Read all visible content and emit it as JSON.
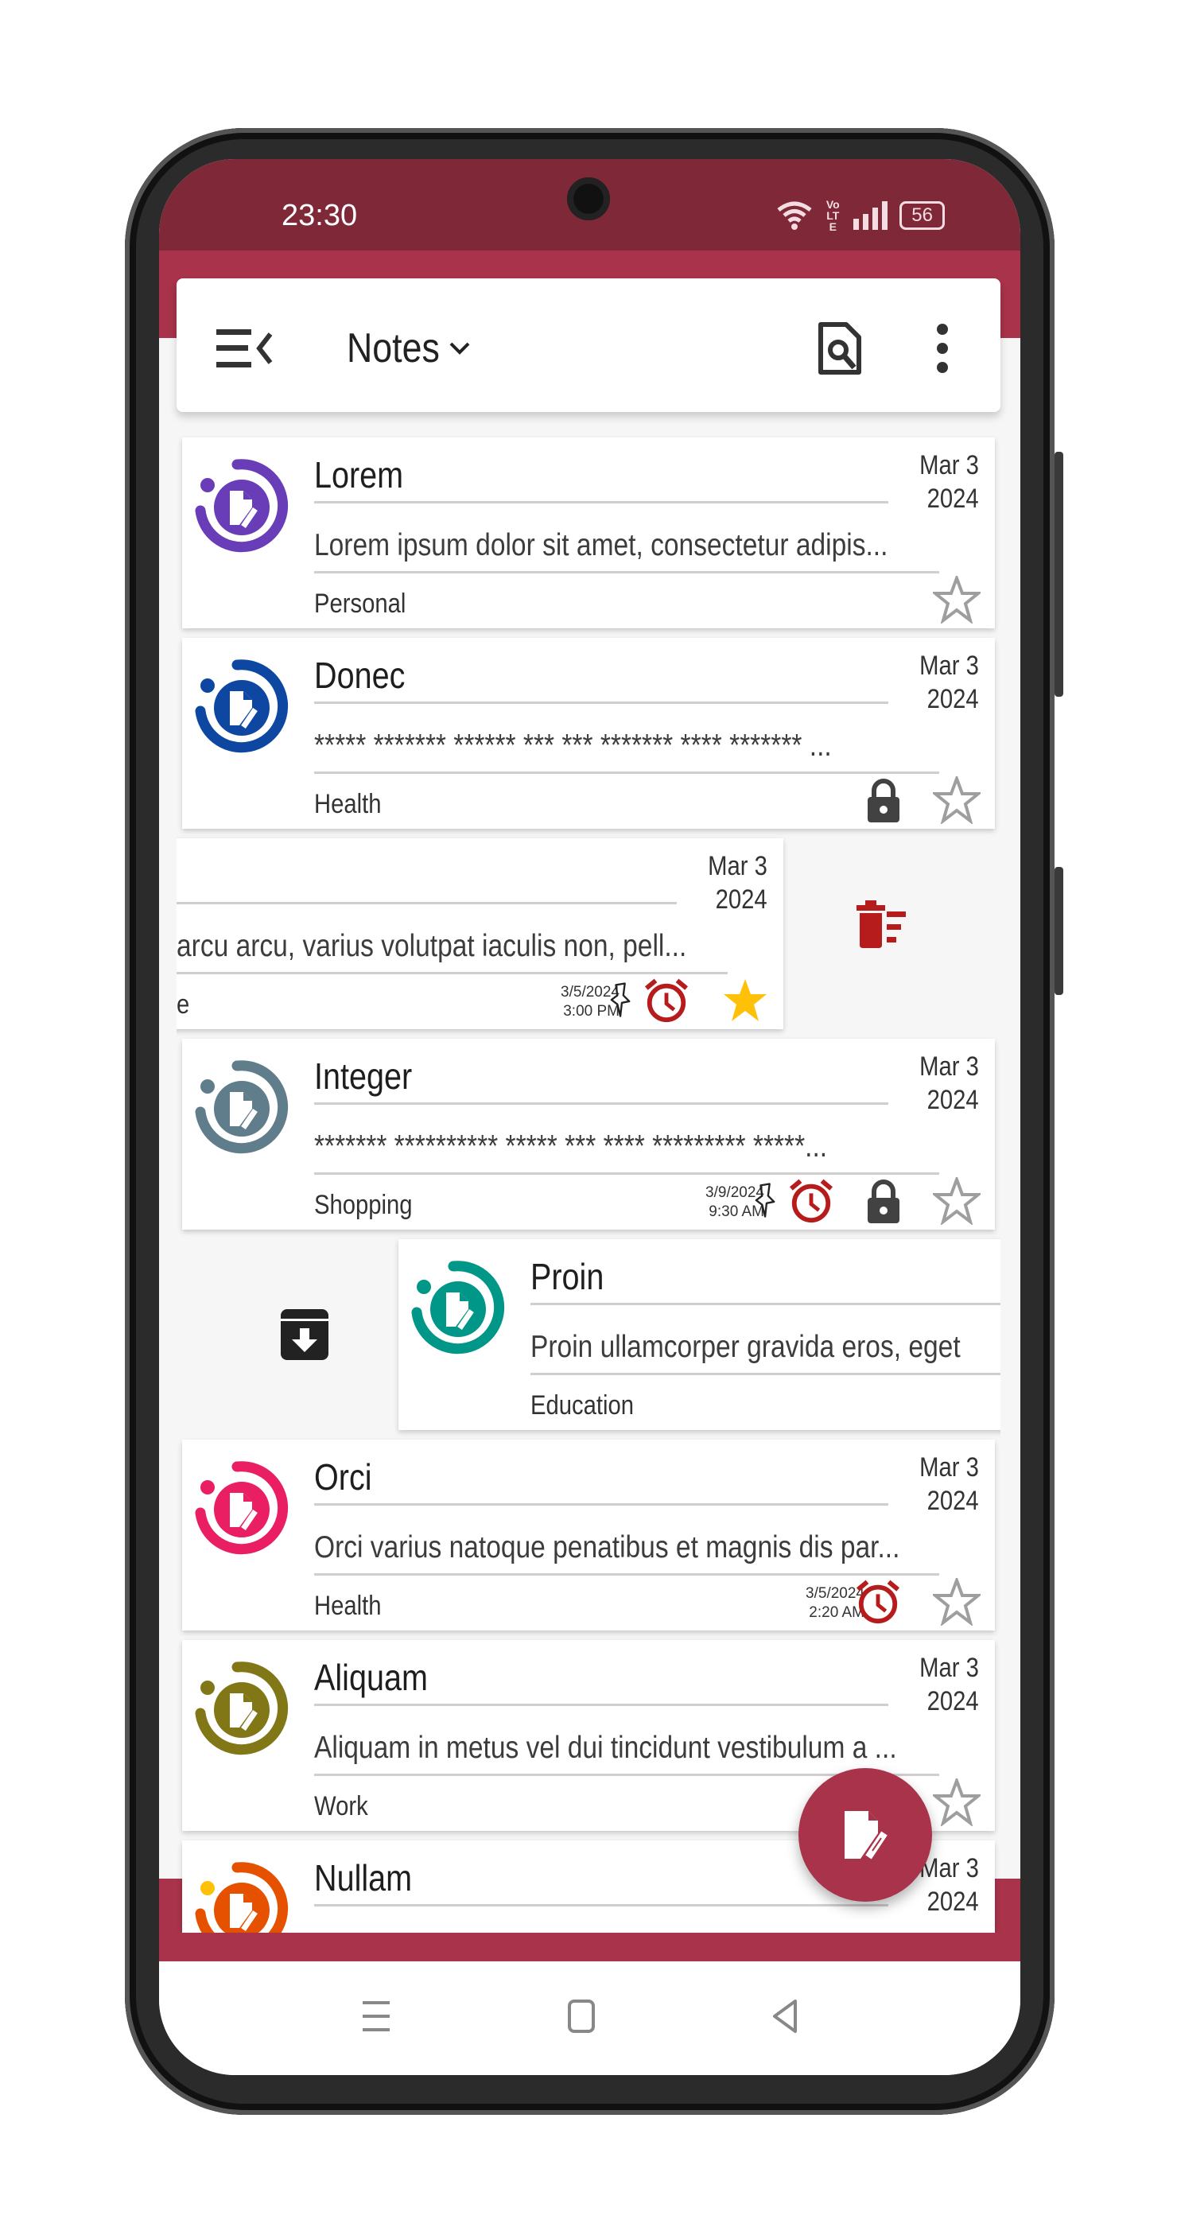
{
  "status_bar": {
    "time": "23:30",
    "network_label": "VoLTE",
    "battery": "56"
  },
  "toolbar": {
    "title": "Notes",
    "menu_icon": "drawer-close-icon",
    "dropdown_icon": "chevron-down-icon",
    "search_icon": "search-document-icon",
    "more_icon": "kebab-menu-icon"
  },
  "colors": {
    "status_bar": "#7f2838",
    "primary": "#a8334a",
    "alarm": "#b71c1c",
    "star_filled": "#ffc107",
    "star_empty": "#9e9e9e",
    "lock": "#424242"
  },
  "notes": [
    {
      "title": "Lorem",
      "date_day": "Mar 3",
      "date_year": "2024",
      "body": "Lorem ipsum dolor sit amet, consectetur adipis...",
      "category": "Personal",
      "color": "#6a3db8",
      "locked": false,
      "starred": false,
      "alarm": false,
      "pinned": false
    },
    {
      "title": "Donec",
      "date_day": "Mar 3",
      "date_year": "2024",
      "body": "***** ******* ****** *** *** ******* **** ******* ...",
      "category": "Health",
      "color": "#0d47a1",
      "locked": true,
      "starred": false,
      "alarm": false,
      "pinned": false
    },
    {
      "title": "",
      "date_day": "Mar 3",
      "date_year": "2024",
      "body": "arcu arcu, varius volutpat iaculis non, pell...",
      "category": "e",
      "color": "#888888",
      "locked": false,
      "starred": true,
      "alarm": true,
      "pinned": true,
      "reminder_date": "3/5/2024",
      "reminder_time": "3:00 PM",
      "swipe": "delete"
    },
    {
      "title": "Integer",
      "date_day": "Mar 3",
      "date_year": "2024",
      "body": "******* ********** ***** *** **** ********* *****...",
      "category": "Shopping",
      "color": "#607d8b",
      "locked": true,
      "starred": false,
      "alarm": true,
      "pinned": true,
      "reminder_date": "3/9/2024",
      "reminder_time": "9:30 AM"
    },
    {
      "title": "Proin",
      "date_day": "",
      "date_year": "",
      "body": "Proin ullamcorper gravida eros, eget",
      "category": "Education",
      "color": "#009688",
      "locked": false,
      "starred": false,
      "alarm": false,
      "pinned": false,
      "swipe": "archive"
    },
    {
      "title": "Orci",
      "date_day": "Mar 3",
      "date_year": "2024",
      "body": "Orci varius natoque penatibus et magnis dis par...",
      "category": "Health",
      "color": "#e91e63",
      "locked": false,
      "starred": false,
      "alarm": true,
      "pinned": false,
      "reminder_date": "3/5/2024",
      "reminder_time": "2:20 AM"
    },
    {
      "title": "Aliquam",
      "date_day": "Mar 3",
      "date_year": "2024",
      "body": "Aliquam in metus vel dui tincidunt vestibulum a ...",
      "category": "Work",
      "color": "#827717",
      "locked": false,
      "starred": false,
      "alarm": false,
      "pinned": false
    },
    {
      "title": "Nullam",
      "date_day": "Mar 3",
      "date_year": "2024",
      "body": "",
      "category": "",
      "color": "#e65100",
      "dot_color": "#ffc107",
      "locked": false,
      "starred": false,
      "alarm": false,
      "pinned": false
    }
  ],
  "swipe_actions": {
    "delete_icon": "delete-sweep-icon",
    "archive_icon": "archive-icon"
  },
  "fab": {
    "icon": "new-note-icon"
  },
  "nav_bar": {
    "items": [
      "recents",
      "home",
      "back"
    ]
  }
}
